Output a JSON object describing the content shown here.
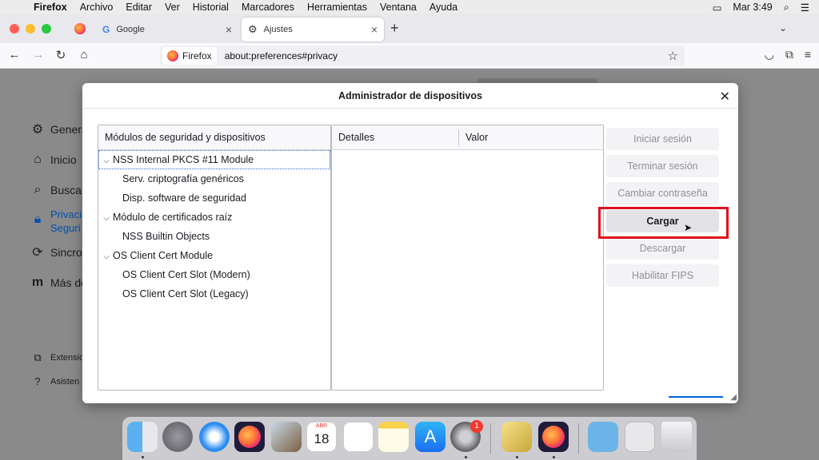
{
  "menubar": {
    "app": "Firefox",
    "items": [
      "Archivo",
      "Editar",
      "Ver",
      "Historial",
      "Marcadores",
      "Herramientas",
      "Ventana",
      "Ayuda"
    ],
    "clock": "Mar 3:49",
    "icons": [
      "apple-icon",
      "display-icon",
      "spotlight-icon",
      "control-center-icon"
    ]
  },
  "tabs": {
    "google": {
      "label": "Google"
    },
    "active": {
      "label": "Ajustes"
    }
  },
  "urlbar": {
    "identity_label": "Firefox",
    "url": "about:preferences#privacy"
  },
  "prefs_nav": {
    "items": [
      "Genera",
      "Inicio",
      "Buscar",
      "Privaci",
      "Seguri",
      "Sincron",
      "Más de"
    ],
    "footer": [
      "Extensio",
      "Asisten"
    ]
  },
  "dialog": {
    "title": "Administrador de dispositivos",
    "tree_header": "Módulos de seguridad y dispositivos",
    "tree": [
      {
        "label": "NSS Internal PKCS #11 Module",
        "level": 0,
        "selected": true
      },
      {
        "label": "Serv. criptografía genéricos",
        "level": 1
      },
      {
        "label": "Disp. software de seguridad",
        "level": 1
      },
      {
        "label": "Módulo de certificados raíz",
        "level": 0
      },
      {
        "label": "NSS Builtin Objects",
        "level": 1
      },
      {
        "label": "OS Client Cert Module",
        "level": 0
      },
      {
        "label": "OS Client Cert Slot (Modern)",
        "level": 1
      },
      {
        "label": "OS Client Cert Slot (Legacy)",
        "level": 1
      }
    ],
    "details_headers": {
      "col1": "Detalles",
      "col2": "Valor"
    },
    "buttons": {
      "login": "Iniciar sesión",
      "logout": "Terminar sesión",
      "change_password": "Cambiar contraseña",
      "load": "Cargar",
      "unload": "Descargar",
      "fips": "Habilitar FIPS"
    }
  },
  "dock": {
    "calendar_month": "ABR",
    "calendar_day": "18",
    "appstore_badge": "1"
  }
}
